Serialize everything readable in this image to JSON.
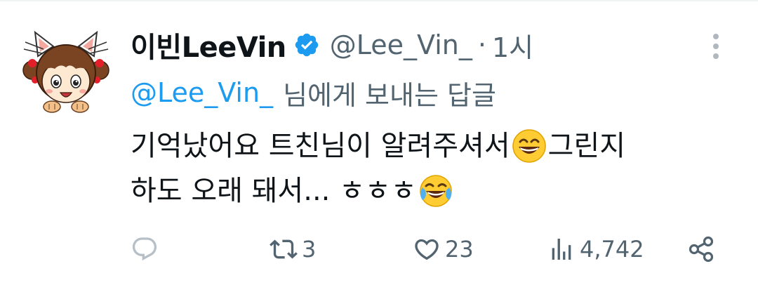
{
  "tweet": {
    "display_name": "이빈LeeVin",
    "handle": "@Lee_Vin_",
    "separator": "·",
    "time": "1시",
    "reply_mention": "@Lee_Vin_",
    "reply_suffix": "님에게 보내는 답글",
    "text_line1_part1": "기억났어요 트친님이 알려주셔서 ",
    "text_line1_part2": "그린지",
    "text_line2": "하도 오래 돼서... ㅎㅎㅎ",
    "emoji1": "grinning-face-with-smiling-eyes",
    "emoji2": "face-with-tears-of-joy"
  },
  "actions": {
    "reply_count": "",
    "retweet_count": "3",
    "like_count": "23",
    "views_count": "4,742"
  },
  "colors": {
    "accent": "#1d9bf0",
    "secondary_text": "#536471",
    "icon": "#536471"
  }
}
